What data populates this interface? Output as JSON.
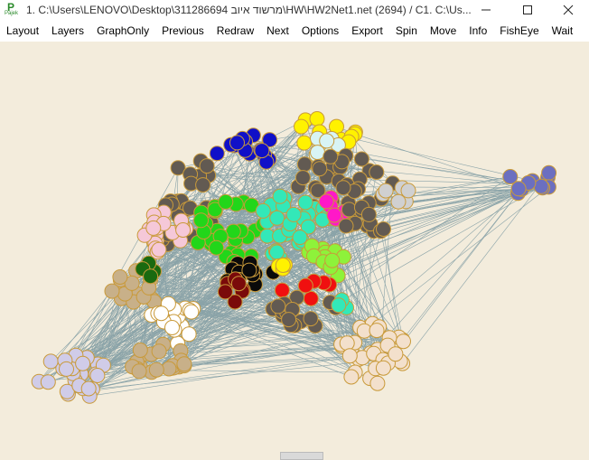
{
  "window": {
    "icon_label": "P",
    "icon_sub": "Pajek",
    "title": "1. C:\\Users\\LENOVO\\Desktop\\311286694 מרשוד איוב\\HW\\HW2Net1.net (2694) / C1. C:\\Us..."
  },
  "menu": [
    "Layout",
    "Layers",
    "GraphOnly",
    "Previous",
    "Redraw",
    "Next",
    "Options",
    "Export",
    "Spin",
    "Move",
    "Info",
    "FishEye",
    "Wait"
  ],
  "graph": {
    "background": "#f3ecdc",
    "edge_color": "#8aa3a8",
    "node_stroke": "#c99a3a",
    "clusters": [
      {
        "name": "yellow",
        "fill": "#fff200"
      },
      {
        "name": "blue",
        "fill": "#1010c8"
      },
      {
        "name": "dark-gray",
        "fill": "#625a52"
      },
      {
        "name": "slate-blue",
        "fill": "#6b6fc0"
      },
      {
        "name": "pink",
        "fill": "#f5c8d8"
      },
      {
        "name": "green",
        "fill": "#22d61a"
      },
      {
        "name": "aquamarine",
        "fill": "#33e8b8"
      },
      {
        "name": "light-green",
        "fill": "#8ef23a"
      },
      {
        "name": "magenta",
        "fill": "#ff18c8"
      },
      {
        "name": "black",
        "fill": "#0a0a0a"
      },
      {
        "name": "maroon",
        "fill": "#7a0a0a"
      },
      {
        "name": "red",
        "fill": "#f01010"
      },
      {
        "name": "light-gray",
        "fill": "#d0d0d0"
      },
      {
        "name": "white",
        "fill": "#ffffff"
      },
      {
        "name": "tan",
        "fill": "#c8b089"
      },
      {
        "name": "lavender",
        "fill": "#d0cce8"
      },
      {
        "name": "bisque",
        "fill": "#f3e0cc"
      },
      {
        "name": "dark-green",
        "fill": "#1a6a10"
      },
      {
        "name": "cyan-light",
        "fill": "#d8f4f4"
      }
    ]
  }
}
